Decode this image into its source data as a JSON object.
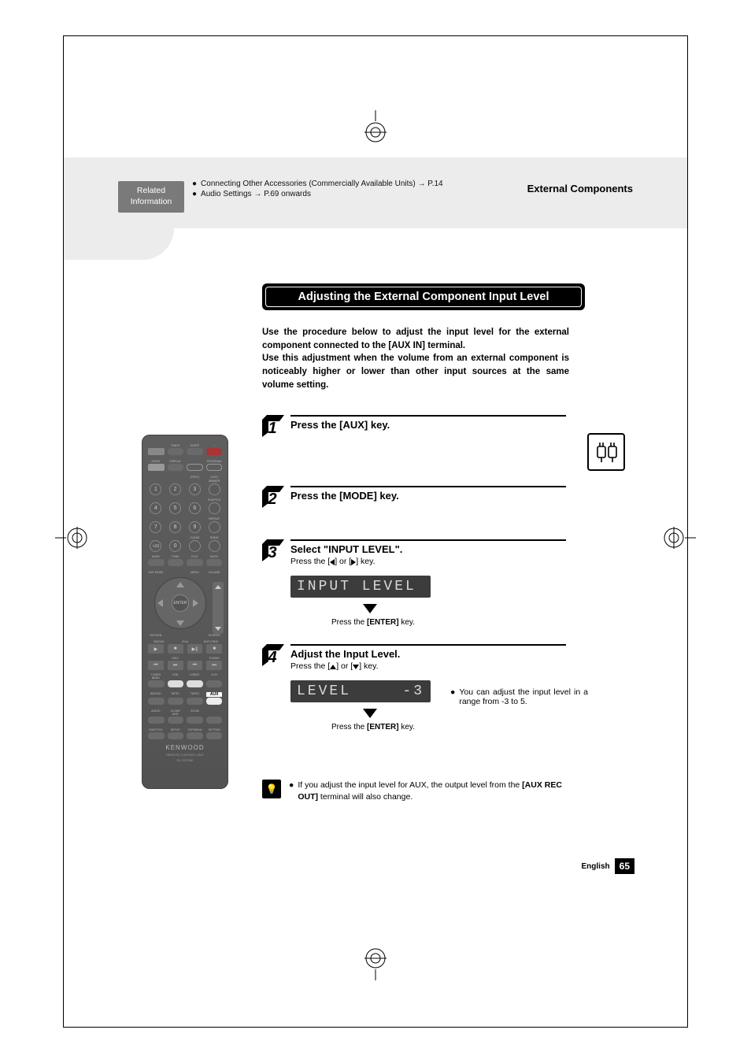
{
  "header": {
    "section_title": "External Components",
    "related_label_1": "Related",
    "related_label_2": "Information",
    "notes": [
      "Connecting Other Accessories (Commercially Available Units) → P.14",
      "Audio Settings → P.69 onwards"
    ]
  },
  "main": {
    "title": "Adjusting the External Component Input Level",
    "intro": "Use the procedure below to adjust the input level for the external component connected to the [AUX IN] terminal.\nUse this adjustment when the volume from an external component is noticeably higher or lower than other input sources at the same volume setting."
  },
  "steps": {
    "s1": {
      "num": "1",
      "title": "Press the [AUX] key."
    },
    "s2": {
      "num": "2",
      "title": "Press the [MODE] key."
    },
    "s3": {
      "num": "3",
      "title": "Select \"INPUT LEVEL\".",
      "sub_pre": "Press the [",
      "sub_mid": "] or [",
      "sub_post": "] key.",
      "display": "INPUT LEVEL",
      "enter_pre": "Press the ",
      "enter_bold": "[ENTER]",
      "enter_post": " key."
    },
    "s4": {
      "num": "4",
      "title": "Adjust the Input Level.",
      "sub_pre": "Press the [",
      "sub_mid": "] or [",
      "sub_post": "] key.",
      "display_left": "LEVEL",
      "display_right": "-3",
      "enter_pre": "Press the ",
      "enter_bold": "[ENTER]",
      "enter_post": " key.",
      "range_note": "You can adjust the input level in a range from -3 to 5."
    }
  },
  "tip": {
    "text_pre": "If you adjust the input level for AUX, the output level from the ",
    "text_bold": "[AUX REC OUT]",
    "text_post": " terminal will also change."
  },
  "footer": {
    "lang": "English",
    "page": "65"
  },
  "remote": {
    "row1_labels": [
      "",
      "TIMER",
      "SLEEP",
      ""
    ],
    "row2_labels": [
      "MODE",
      "DISPLAY",
      "",
      "PROGRAM"
    ],
    "row2b_labels": [
      "",
      "",
      "(TEXT)",
      "(CAT)"
    ],
    "num_side_labels": [
      "DIMMER",
      "SHUFFLE",
      "REPEAT",
      "RNDM"
    ],
    "clear_label": "CLEAR",
    "numbers": [
      "1",
      "2",
      "3",
      "4",
      "5",
      "6",
      "7",
      "8",
      "9",
      "+10",
      "0"
    ],
    "row_tone_labels": [
      "BASS",
      "TONE",
      "FLAT",
      "MUTE"
    ],
    "sur_label": "SUR MODE",
    "menu_label": "MENU",
    "vol_label": "VOLUME",
    "enter": "ENTER",
    "return_label": "RETURN",
    "screen_label": "SCREEN",
    "transport_labels": [
      "BD/DVD",
      "iPod",
      "AUTO RNV"
    ],
    "transport2_labels": [
      "",
      "DISC",
      "",
      "TUNING",
      ""
    ],
    "src_labels": [
      "TUNER BAND",
      "USB",
      "iUSB/D",
      "D-IN"
    ],
    "src_labels2": [
      "BD/DVD",
      "TAPE1",
      "TAPE2",
      "AUX"
    ],
    "bot_labels": [
      "AUDIO",
      "CLEAR ANG",
      "ZOOM",
      ""
    ],
    "bot_labels2": [
      "SUBTITLE",
      "SETUP",
      "TOPMENU",
      "SETTING"
    ],
    "aux": "AUX",
    "logo": "KENWOOD",
    "sub1": "REMOTE CONTROL UNIT",
    "sub2": "RC-F0705E"
  }
}
